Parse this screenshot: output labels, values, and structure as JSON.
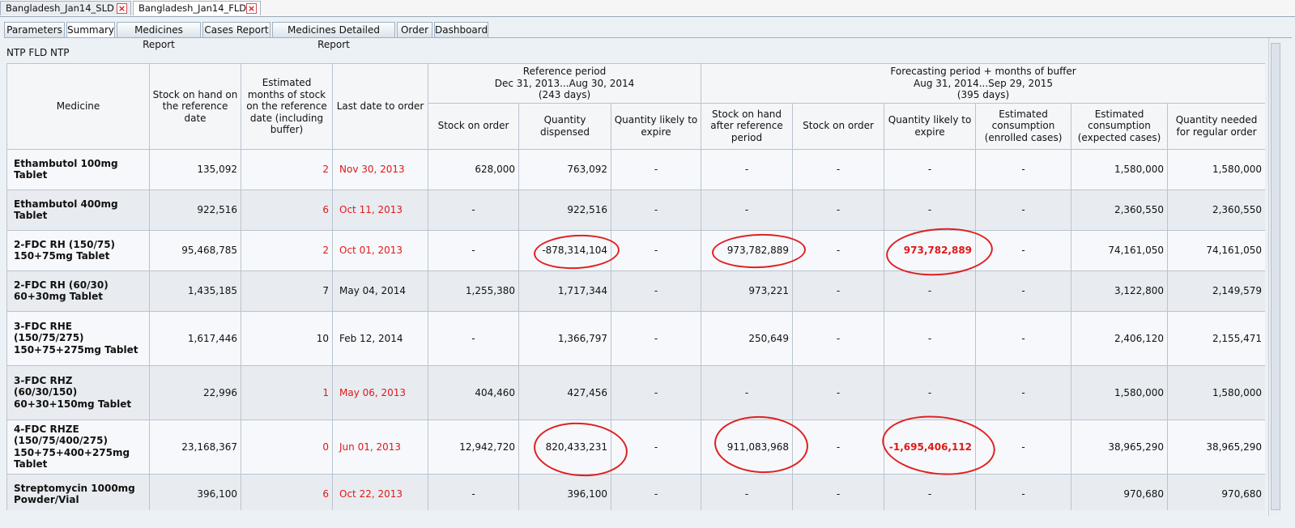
{
  "doc_tabs": [
    {
      "label": "Bangladesh_Jan14_SLD",
      "active": false
    },
    {
      "label": "Bangladesh_Jan14_FLD",
      "active": true
    }
  ],
  "view_tabs": [
    "Parameters",
    "Summary",
    "Medicines Report",
    "Cases Report",
    "Medicines Detailed Report",
    "Order",
    "Dashboard"
  ],
  "active_view_tab": "Summary",
  "report_title": "NTP FLD NTP",
  "headers": {
    "medicine": "Medicine",
    "stock_on_hand": "Stock on hand on the reference date",
    "est_months": "Estimated months of stock on the reference date (including buffer)",
    "last_date": "Last date to order",
    "reference_group": [
      "Reference period",
      "Dec 31, 2013...Aug 30, 2014",
      "(243 days)"
    ],
    "forecast_group": [
      "Forecasting period + months of buffer",
      "Aug 31, 2014...Sep 29, 2015",
      "(395 days)"
    ],
    "ref_stock_on_order": "Stock on order",
    "ref_qty_dispensed": "Quantity dispensed",
    "ref_qty_expire": "Quantity likely to expire",
    "fc_stock_after": "Stock on hand after reference period",
    "fc_stock_on_order": "Stock on order",
    "fc_qty_expire": "Quantity likely to expire",
    "fc_consumption_enrolled": "Estimated consumption (enrolled cases)",
    "fc_consumption_expected": "Estimated consumption (expected cases)",
    "fc_qty_needed": "Quantity needed for regular order"
  },
  "rows": [
    {
      "medicine": [
        "Ethambutol 100mg",
        "Tablet"
      ],
      "stock_on_hand": "135,092",
      "months": "2",
      "months_red": true,
      "last_date": "Nov 30, 2013",
      "date_red": true,
      "ref_stock_on_order": "628,000",
      "ref_qty_dispensed": "763,092",
      "ref_qty_expire": "-",
      "fc_stock_after": "-",
      "fc_stock_on_order": "-",
      "fc_qty_expire": "-",
      "fc_qty_expire_red": false,
      "fc_enrolled": "-",
      "fc_expected": "1,580,000",
      "fc_needed": "1,580,000"
    },
    {
      "medicine": [
        "Ethambutol 400mg",
        "Tablet"
      ],
      "stock_on_hand": "922,516",
      "months": "6",
      "months_red": true,
      "last_date": "Oct 11, 2013",
      "date_red": true,
      "ref_stock_on_order": "-",
      "ref_qty_dispensed": "922,516",
      "ref_qty_expire": "-",
      "fc_stock_after": "-",
      "fc_stock_on_order": "-",
      "fc_qty_expire": "-",
      "fc_qty_expire_red": false,
      "fc_enrolled": "-",
      "fc_expected": "2,360,550",
      "fc_needed": "2,360,550"
    },
    {
      "medicine": [
        "2-FDC RH (150/75)",
        "150+75mg Tablet"
      ],
      "stock_on_hand": "95,468,785",
      "months": "2",
      "months_red": true,
      "last_date": "Oct 01, 2013",
      "date_red": true,
      "ref_stock_on_order": "-",
      "ref_qty_dispensed": "-878,314,104",
      "ref_qty_expire": "-",
      "fc_stock_after": "973,782,889",
      "fc_stock_on_order": "-",
      "fc_qty_expire": "973,782,889",
      "fc_qty_expire_red": true,
      "fc_enrolled": "-",
      "fc_expected": "74,161,050",
      "fc_needed": "74,161,050"
    },
    {
      "medicine": [
        "2-FDC RH (60/30)",
        "60+30mg Tablet"
      ],
      "stock_on_hand": "1,435,185",
      "months": "7",
      "months_red": false,
      "last_date": "May 04, 2014",
      "date_red": false,
      "ref_stock_on_order": "1,255,380",
      "ref_qty_dispensed": "1,717,344",
      "ref_qty_expire": "-",
      "fc_stock_after": "973,221",
      "fc_stock_on_order": "-",
      "fc_qty_expire": "-",
      "fc_qty_expire_red": false,
      "fc_enrolled": "-",
      "fc_expected": "3,122,800",
      "fc_needed": "2,149,579"
    },
    {
      "medicine": [
        "3-FDC RHE",
        "(150/75/275)",
        "150+75+275mg Tablet"
      ],
      "stock_on_hand": "1,617,446",
      "months": "10",
      "months_red": false,
      "last_date": "Feb 12, 2014",
      "date_red": false,
      "ref_stock_on_order": "-",
      "ref_qty_dispensed": "1,366,797",
      "ref_qty_expire": "-",
      "fc_stock_after": "250,649",
      "fc_stock_on_order": "-",
      "fc_qty_expire": "-",
      "fc_qty_expire_red": false,
      "fc_enrolled": "-",
      "fc_expected": "2,406,120",
      "fc_needed": "2,155,471"
    },
    {
      "medicine": [
        "3-FDC RHZ",
        "(60/30/150)",
        "60+30+150mg Tablet"
      ],
      "stock_on_hand": "22,996",
      "months": "1",
      "months_red": true,
      "last_date": "May 06, 2013",
      "date_red": true,
      "ref_stock_on_order": "404,460",
      "ref_qty_dispensed": "427,456",
      "ref_qty_expire": "-",
      "fc_stock_after": "-",
      "fc_stock_on_order": "-",
      "fc_qty_expire": "-",
      "fc_qty_expire_red": false,
      "fc_enrolled": "-",
      "fc_expected": "1,580,000",
      "fc_needed": "1,580,000"
    },
    {
      "medicine": [
        "4-FDC RHZE",
        "(150/75/400/275)",
        "150+75+400+275mg",
        "Tablet"
      ],
      "stock_on_hand": "23,168,367",
      "months": "0",
      "months_red": true,
      "last_date": "Jun 01, 2013",
      "date_red": true,
      "ref_stock_on_order": "12,942,720",
      "ref_qty_dispensed": "820,433,231",
      "ref_qty_expire": "-",
      "fc_stock_after": "911,083,968",
      "fc_stock_on_order": "-",
      "fc_qty_expire": "-1,695,406,112",
      "fc_qty_expire_red": true,
      "fc_enrolled": "-",
      "fc_expected": "38,965,290",
      "fc_needed": "38,965,290"
    },
    {
      "medicine": [
        "Streptomycin 1000mg",
        "Powder/Vial"
      ],
      "stock_on_hand": "396,100",
      "months": "6",
      "months_red": true,
      "last_date": "Oct 22, 2013",
      "date_red": true,
      "ref_stock_on_order": "-",
      "ref_qty_dispensed": "396,100",
      "ref_qty_expire": "-",
      "fc_stock_after": "-",
      "fc_stock_on_order": "-",
      "fc_qty_expire": "-",
      "fc_qty_expire_red": false,
      "fc_enrolled": "-",
      "fc_expected": "970,680",
      "fc_needed": "970,680"
    }
  ],
  "colors": {
    "alert_red": "#e01818",
    "annotation_red": "#e02020",
    "header_bg": "#f4f6f8",
    "grid": "#b9c4cf"
  }
}
